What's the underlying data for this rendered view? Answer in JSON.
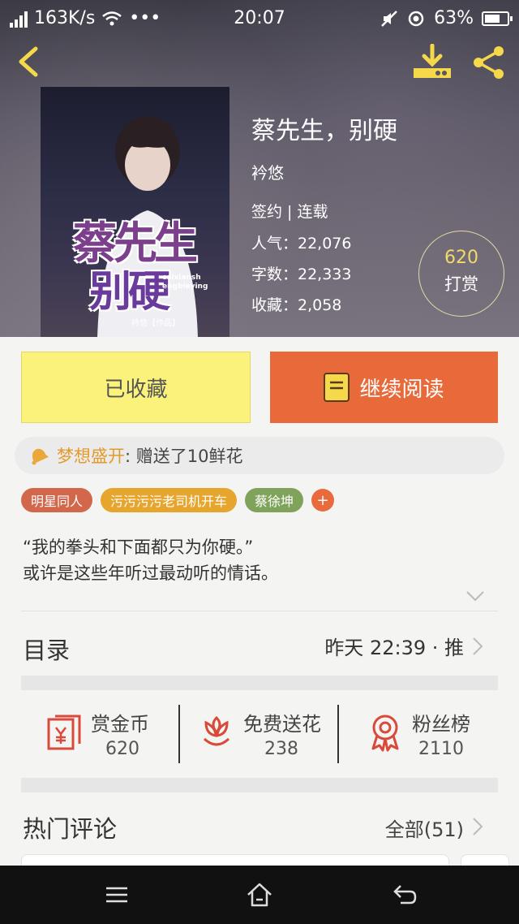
{
  "status_bar": {
    "net_speed": "163K/s",
    "dots": "•••",
    "time": "20:07",
    "battery": "63%"
  },
  "book": {
    "title": "蔡先生，别硬",
    "author": "衿悠",
    "status": "签约 | 连载",
    "popularity": "人气：22,076",
    "word_count": "字数：22,333",
    "favorites": "收藏：2,058"
  },
  "cover": {
    "title_line1": "蔡先生",
    "title_line2": "别硬",
    "pinyin_line1": "caixiansh",
    "pinyin_line2": "engbieying",
    "credit": "衿悠【作品】"
  },
  "reward": {
    "count": "620",
    "label": "打赏"
  },
  "actions": {
    "collected": "已收藏",
    "continue_reading": "继续阅读"
  },
  "gift": {
    "user": "梦想盛开",
    "text": ": 赠送了10鲜花"
  },
  "tags": [
    {
      "label": "明星同人",
      "color": "#d2674b"
    },
    {
      "label": "污污污污老司机开车",
      "color": "#e6a52c"
    },
    {
      "label": "蔡徐坤",
      "color": "#7fa35a"
    }
  ],
  "tag_add": "+",
  "summary": {
    "line1": "“我的拳头和下面都只为你硬。”",
    "line2": "或许是这些年听过最动听的情话。"
  },
  "toc": {
    "label": "目录",
    "update": "昨天 22:39 · 推"
  },
  "stats": [
    {
      "name": "赏金币",
      "value": "620",
      "icon": "red-envelope-icon"
    },
    {
      "name": "免费送花",
      "value": "238",
      "icon": "flower-icon"
    },
    {
      "name": "粉丝榜",
      "value": "2110",
      "icon": "medal-icon"
    }
  ],
  "comments": {
    "label": "热门评论",
    "all": "全部(51)"
  },
  "colors": {
    "accent_orange": "#e8693a",
    "collected_yellow": "#fbf27c",
    "stat_red": "#d94a3a",
    "gift_user": "#e39a2d"
  }
}
